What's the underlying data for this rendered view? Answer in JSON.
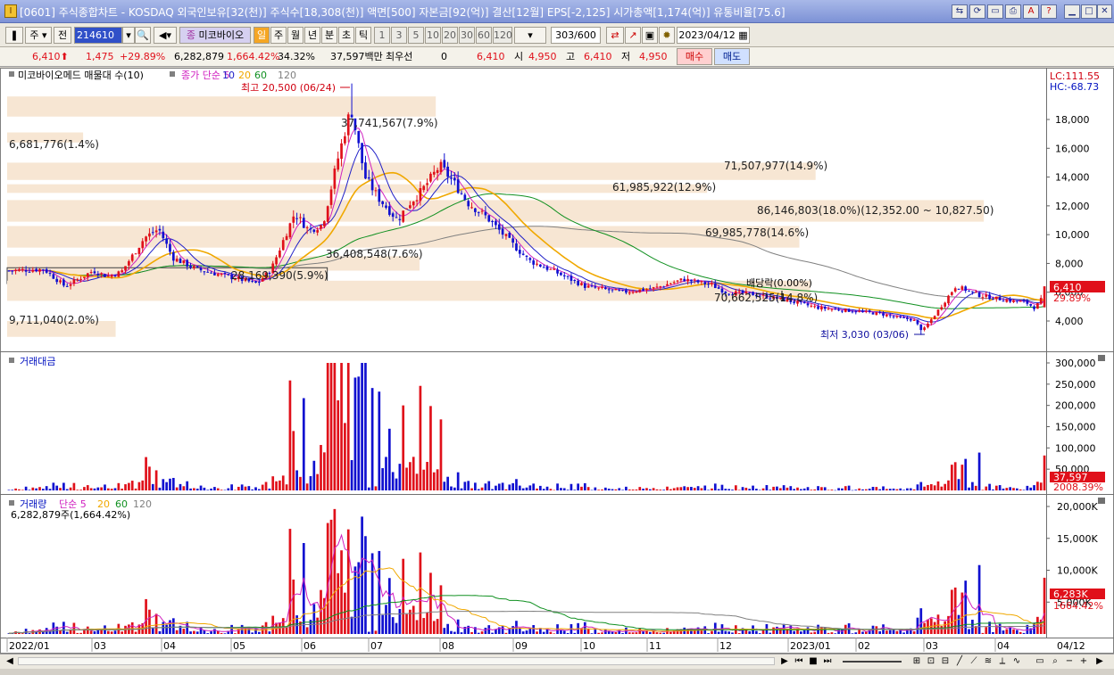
{
  "window": {
    "title": "[0601] 주식종합차트 - KOSDAQ 외국인보유[32(천)] 주식수[18,308(천)] 액면[500] 자본금[92(억)] 결산[12월] EPS[-2,125] 시가총액[1,174(억)] 유통비율[75.6]"
  },
  "toolbar": {
    "type_select": "주",
    "prev_btn": "전",
    "code": "214610",
    "stock_name": "미코바이오",
    "periods": [
      "일",
      "주",
      "월",
      "년",
      "분",
      "초",
      "틱"
    ],
    "active_period": "일",
    "intervals": [
      "1",
      "3",
      "5",
      "10",
      "20",
      "30",
      "60",
      "120"
    ],
    "count": "303",
    "count_total": "/600",
    "date": "2023/04/12"
  },
  "quote": {
    "price": "6,410",
    "change": "1,475",
    "change_pct": "+29.89%",
    "volume": "6,282,879",
    "volume_pct": "1,664.42%",
    "turnover": "34.32%",
    "amount": "37,597백만",
    "best_label": "최우선",
    "best_value": "0",
    "ask_price": "6,410",
    "open_label": "시",
    "open": "4,950",
    "high_label": "고",
    "high": "6,410",
    "low_label": "저",
    "low": "4,950",
    "buy_btn": "매수",
    "sell_btn": "매도"
  },
  "colors": {
    "up": "#e0101a",
    "down": "#1010d0",
    "ma5": "#d020c0",
    "ma10": "#2020c8",
    "ma20": "#f0a800",
    "ma60": "#109020",
    "ma120": "#808080",
    "band": "#f7e6d3"
  },
  "price_panel": {
    "name": "미코바이오메드 매물대 수(10)",
    "ma_label": "종가 단순",
    "ma_periods": [
      "5",
      "10",
      "20",
      "60",
      "120"
    ],
    "lc": "LC:111.55",
    "hc": "HC:-68.73",
    "high_note": "최고 20,500 (06/24)",
    "low_note": "최저 3,030 (03/06)",
    "ex_div": "배당락(0.00%)",
    "y_ticks": [
      "18,000",
      "16,000",
      "14,000",
      "12,000",
      "10,000",
      "8,000",
      "6,000",
      "4,000"
    ],
    "last_price": "6,410",
    "last_pct": "29.89%",
    "volume_profile": [
      {
        "label": "37,741,567(7.9%)",
        "pct": 7.9
      },
      {
        "label": "6,681,776(1.4%)",
        "pct": 1.4
      },
      {
        "label": "71,507,977(14.9%)",
        "pct": 14.9
      },
      {
        "label": "61,985,922(12.9%)",
        "pct": 12.9
      },
      {
        "label": "86,146,803(18.0%)(12,352.00 ~ 10,827.50)",
        "pct": 18.0
      },
      {
        "label": "69,985,778(14.6%)",
        "pct": 14.6
      },
      {
        "label": "36,408,548(7.6%)",
        "pct": 7.6
      },
      {
        "label": "28,169,390(5.9%)",
        "pct": 5.9
      },
      {
        "label": "70,662,525(14.8%)",
        "pct": 14.8
      },
      {
        "label": "9,711,040(2.0%)",
        "pct": 2.0
      }
    ]
  },
  "amount_panel": {
    "name": "거래대금",
    "y_ticks": [
      "300,000",
      "250,000",
      "200,000",
      "150,000",
      "100,000",
      "50,000"
    ],
    "last_value": "37,597",
    "last_pct": "2008.39%"
  },
  "volume_panel": {
    "name": "거래량",
    "ma_label": "단순",
    "ma_periods": [
      "5",
      "20",
      "60",
      "120"
    ],
    "sub_label": "6,282,879주(1,664.42%)",
    "y_ticks": [
      "20,000K",
      "15,000K",
      "10,000K",
      "5,000K"
    ],
    "last_value": "6,283K",
    "last_pct": "1664.42%"
  },
  "x_axis": {
    "labels": [
      "2022/01",
      "03",
      "04",
      "05",
      "06",
      "07",
      "08",
      "09",
      "10",
      "11",
      "12",
      "2023/01",
      "02",
      "03",
      "04"
    ],
    "right_label": "04/12"
  },
  "chart_data": {
    "type": "candlestick",
    "title": "미코바이오메드 매물대 수(10)",
    "y_range": [
      3030,
      20500
    ],
    "keypoints": [
      {
        "date": "2022/01",
        "close": 7500
      },
      {
        "date": "2022/03",
        "close": 7200
      },
      {
        "date": "2022/03 late",
        "close": 10800
      },
      {
        "date": "2022/04",
        "close": 8400
      },
      {
        "date": "2022/05",
        "close": 7200
      },
      {
        "date": "2022/06 early",
        "close": 11800
      },
      {
        "date": "2022/06/24",
        "close": 20500
      },
      {
        "date": "2022/07 early",
        "close": 11500
      },
      {
        "date": "2022/07 late",
        "close": 15800
      },
      {
        "date": "2022/08",
        "close": 12000
      },
      {
        "date": "2022/09",
        "close": 8000
      },
      {
        "date": "2022/10",
        "close": 6000
      },
      {
        "date": "2022/11",
        "close": 6600
      },
      {
        "date": "2022/12",
        "close": 5500
      },
      {
        "date": "2023/01",
        "close": 4700
      },
      {
        "date": "2023/02",
        "close": 4300
      },
      {
        "date": "2023/03/06",
        "close": 3030
      },
      {
        "date": "2023/03 mid",
        "close": 6800
      },
      {
        "date": "2023/04",
        "close": 5200
      },
      {
        "date": "2023/04/12",
        "close": 6410
      }
    ]
  }
}
